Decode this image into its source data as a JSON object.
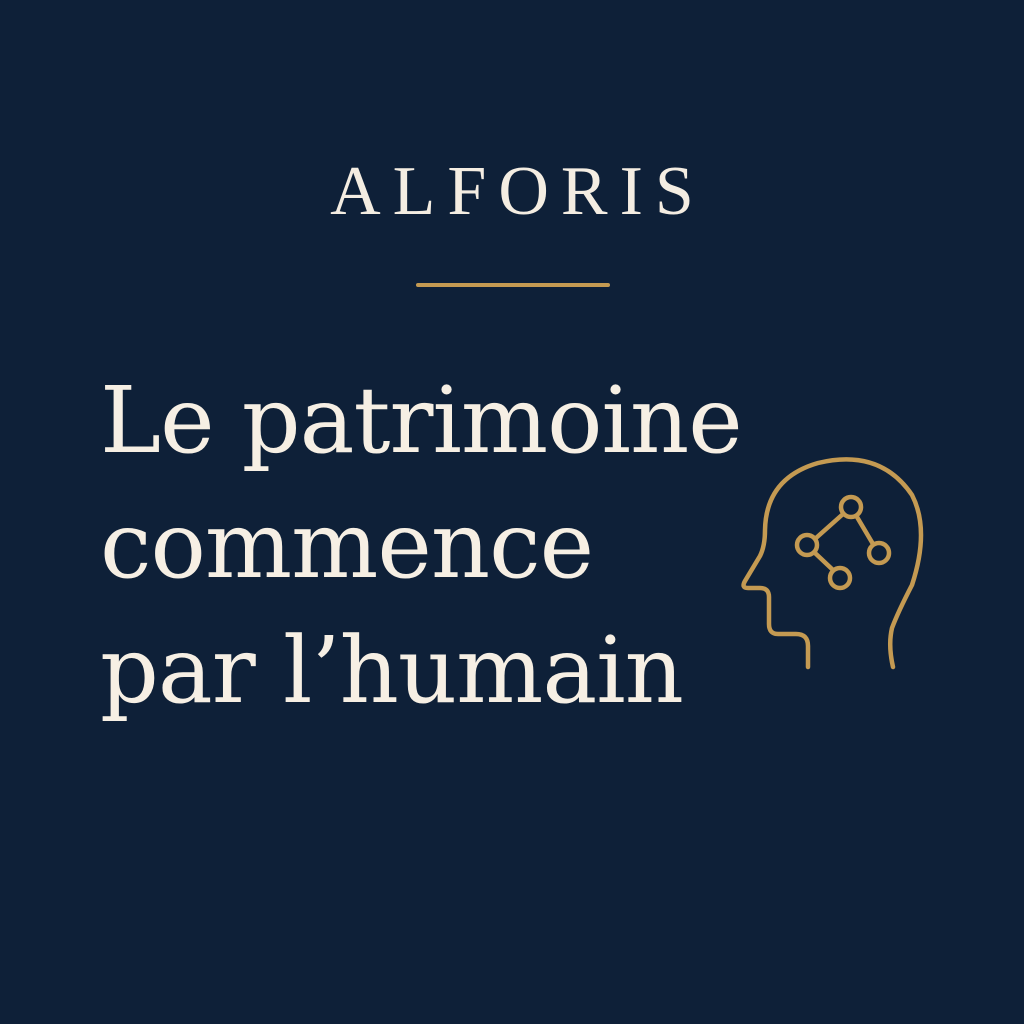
{
  "brand": {
    "name": "ALFORIS"
  },
  "headline": {
    "lines": [
      "Le patrimoine",
      "commence",
      "par l’humain"
    ]
  },
  "icons": {
    "illustration": "head-network-icon"
  },
  "colors": {
    "background": "#0e2038",
    "accent": "#c49a52",
    "text": "#f6efe4"
  }
}
